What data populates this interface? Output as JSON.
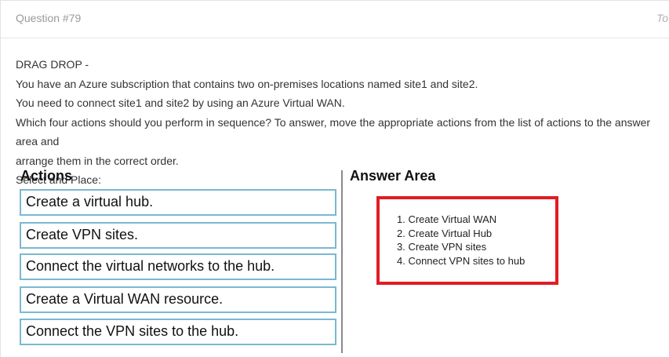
{
  "header": {
    "question_number": "Question #79",
    "right_text": "To"
  },
  "question": {
    "type_label": "DRAG DROP -",
    "lines": [
      "You have an Azure subscription that contains two on-premises locations named site1 and site2.",
      "You need to connect site1 and site2 by using an Azure Virtual WAN.",
      "Which four actions should you perform in sequence? To answer, move the appropriate actions from the list of actions to the answer area and",
      "arrange them in the correct order.",
      "Select and Place:"
    ]
  },
  "actions": {
    "title": "Actions",
    "items": [
      "Create a virtual hub.",
      "Create VPN sites.",
      "Connect the virtual networks to the hub.",
      "Create a Virtual WAN resource.",
      "Connect the VPN sites to the hub."
    ]
  },
  "answer_area": {
    "title": "Answer Area",
    "items": [
      "1. Create Virtual WAN",
      "2. Create Virtual Hub",
      "3. Create VPN sites",
      "4. Connect VPN sites to hub"
    ]
  },
  "colors": {
    "action_border": "#7ab9cf",
    "answer_border": "#e11c25"
  }
}
